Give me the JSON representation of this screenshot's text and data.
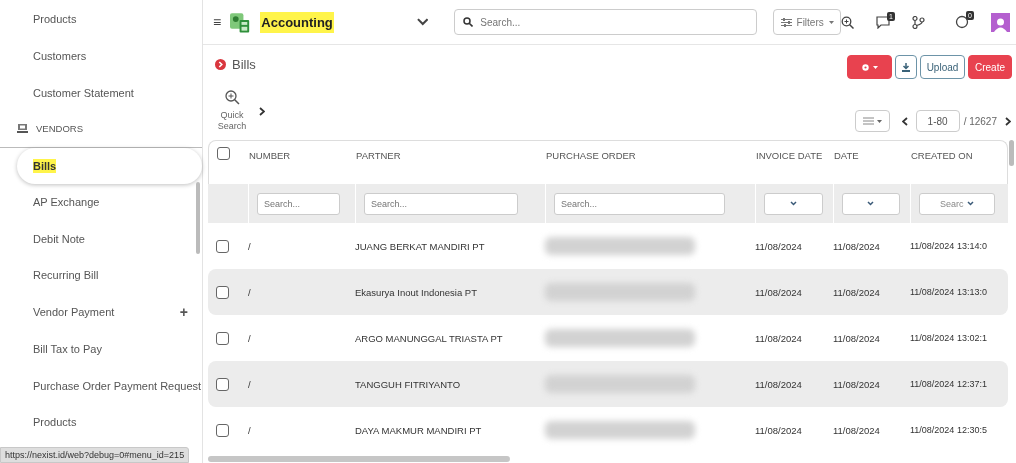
{
  "sidebar": {
    "items": [
      {
        "label": "Products",
        "kind": "item",
        "selected": false
      },
      {
        "label": "Customers",
        "kind": "item",
        "selected": false
      },
      {
        "label": "Customer Statement",
        "kind": "item",
        "selected": false
      },
      {
        "label": "VENDORS",
        "kind": "section"
      },
      {
        "label": "Bills",
        "kind": "item",
        "selected": true
      },
      {
        "label": "AP Exchange",
        "kind": "item",
        "selected": false
      },
      {
        "label": "Debit Note",
        "kind": "item",
        "selected": false
      },
      {
        "label": "Recurring Bill",
        "kind": "item",
        "selected": false
      },
      {
        "label": "Vendor Payment",
        "kind": "item",
        "selected": false,
        "action": "+"
      },
      {
        "label": "Bill Tax to Pay",
        "kind": "item",
        "selected": false
      },
      {
        "label": "Purchase Order Payment Request",
        "kind": "item",
        "selected": false
      },
      {
        "label": "Products",
        "kind": "item",
        "selected": false
      }
    ]
  },
  "topbar": {
    "menu_glyph": "≡",
    "app_name": "Accounting",
    "app_name_highlighted": true,
    "search": {
      "placeholder": "Search..."
    },
    "filters_label": "Filters",
    "message_count": "1",
    "activity_count": "0"
  },
  "page": {
    "title": "Bills",
    "quick_search_label": "Quick Search",
    "upload_label": "Upload",
    "create_label": "Create",
    "pager_range": "1-80",
    "pager_total": "/ 12627"
  },
  "table": {
    "all_checked": false,
    "columns": [
      {
        "label": "NUMBER",
        "kind": "text",
        "placeholder": "Search..."
      },
      {
        "label": "PARTNER",
        "kind": "text",
        "placeholder": "Search..."
      },
      {
        "label": "PURCHASE ORDER",
        "kind": "text",
        "placeholder": "Search..."
      },
      {
        "label": "INVOICE DATE",
        "kind": "select"
      },
      {
        "label": "DATE",
        "kind": "select"
      },
      {
        "label": "CREATED ON",
        "kind": "select",
        "placeholder": "Searc"
      }
    ],
    "rows": [
      {
        "checked": false,
        "number": "/",
        "partner": "JUANG BERKAT MANDIRI PT",
        "purchase_order_blurred": true,
        "invoice_date": "11/08/2024",
        "date": "11/08/2024",
        "created_on": "11/08/2024 13:14:0"
      },
      {
        "checked": false,
        "number": "/",
        "partner": "Ekasurya Inout Indonesia PT",
        "purchase_order_blurred": true,
        "invoice_date": "11/08/2024",
        "date": "11/08/2024",
        "created_on": "11/08/2024 13:13:0"
      },
      {
        "checked": false,
        "number": "/",
        "partner": "ARGO MANUNGGAL TRIASTA PT",
        "purchase_order_blurred": true,
        "invoice_date": "11/08/2024",
        "date": "11/08/2024",
        "created_on": "11/08/2024 13:02:1"
      },
      {
        "checked": false,
        "number": "/",
        "partner": "TANGGUH FITRIYANTO",
        "purchase_order_blurred": true,
        "invoice_date": "11/08/2024",
        "date": "11/08/2024",
        "created_on": "11/08/2024 12:37:1"
      },
      {
        "checked": false,
        "number": "/",
        "partner": "DAYA MAKMUR MANDIRI PT",
        "purchase_order_blurred": true,
        "invoice_date": "11/08/2024",
        "date": "11/08/2024",
        "created_on": "11/08/2024 12:30:5"
      }
    ]
  },
  "status_bar": {
    "url": "https://nexist.id/web?debug=0#menu_id=215"
  }
}
